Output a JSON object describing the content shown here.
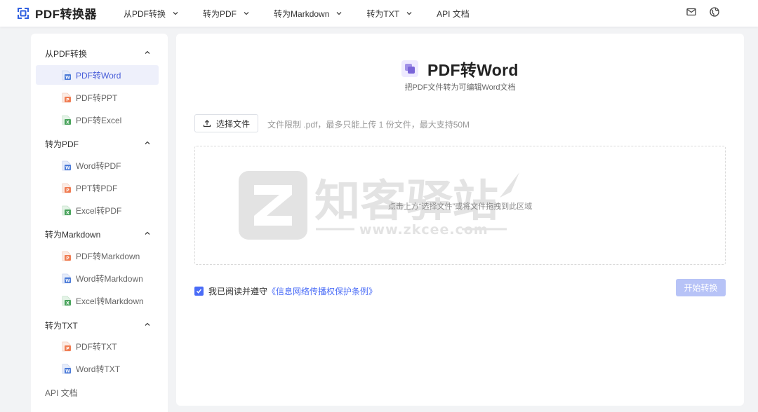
{
  "app": {
    "name": "PDF转换器"
  },
  "nav": {
    "items": [
      {
        "label": "从PDF转换",
        "has_dropdown": true
      },
      {
        "label": "转为PDF",
        "has_dropdown": true
      },
      {
        "label": "转为Markdown",
        "has_dropdown": true
      },
      {
        "label": "转为TXT",
        "has_dropdown": true
      },
      {
        "label": "API 文档",
        "has_dropdown": false
      }
    ],
    "icons": [
      "mail-icon",
      "globe-icon"
    ]
  },
  "sidebar": {
    "groups": [
      {
        "title": "从PDF转换",
        "expanded": true,
        "items": [
          {
            "label": "PDF转Word",
            "icon": "word-file-icon",
            "active": true
          },
          {
            "label": "PDF转PPT",
            "icon": "ppt-file-icon"
          },
          {
            "label": "PDF转Excel",
            "icon": "excel-file-icon"
          }
        ]
      },
      {
        "title": "转为PDF",
        "expanded": true,
        "items": [
          {
            "label": "Word转PDF",
            "icon": "word-file-icon"
          },
          {
            "label": "PPT转PDF",
            "icon": "ppt-file-icon"
          },
          {
            "label": "Excel转PDF",
            "icon": "excel-file-icon"
          }
        ]
      },
      {
        "title": "转为Markdown",
        "expanded": true,
        "items": [
          {
            "label": "PDF转Markdown",
            "icon": "ppt-file-icon"
          },
          {
            "label": "Word转Markdown",
            "icon": "word-file-icon"
          },
          {
            "label": "Excel转Markdown",
            "icon": "excel-file-icon"
          }
        ]
      },
      {
        "title": "转为TXT",
        "expanded": true,
        "items": [
          {
            "label": "PDF转TXT",
            "icon": "ppt-file-icon"
          },
          {
            "label": "Word转TXT",
            "icon": "word-file-icon"
          }
        ]
      }
    ],
    "api_label": "API 文档"
  },
  "main": {
    "title": "PDF转Word",
    "subtitle": "把PDF文件转为可编辑Word文档",
    "upload_label": "选择文件",
    "limit_text": "文件限制 .pdf，最多只能上传 1 份文件，最大支持50M",
    "drop_hint": "点击上方“选择文件”或将文件拖拽到此区域",
    "watermark": {
      "text": "知客驿站",
      "url": "www.zkcee.com"
    },
    "agree_prefix": "我已阅读并遵守",
    "agree_link": "《信息网络传播权保护条例》",
    "agree_checked": true,
    "start_label": "开始转换"
  },
  "colors": {
    "accent": "#4a6cf7",
    "word": "#4a7ad8",
    "ppt": "#f07c52",
    "excel": "#49a35c",
    "start_disabled": "#b7c3f7"
  }
}
